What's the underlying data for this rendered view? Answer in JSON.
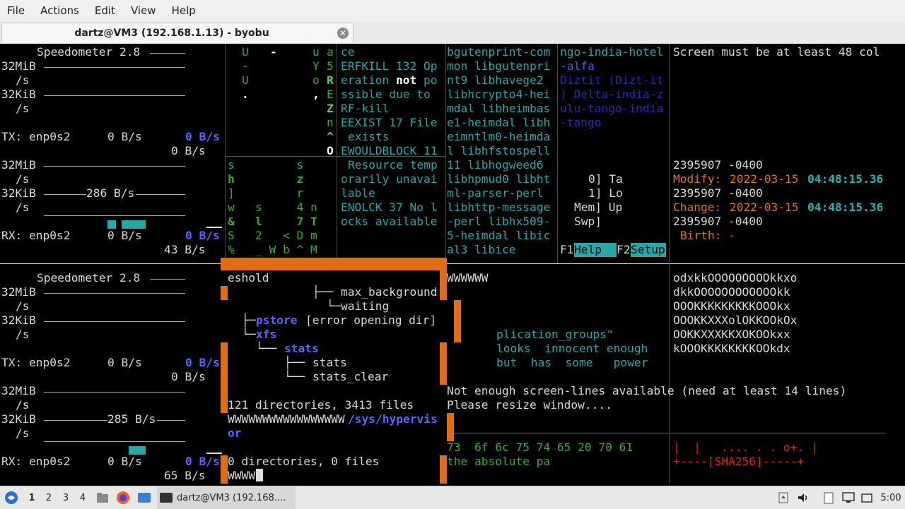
{
  "menubar": {
    "items": [
      "File",
      "Actions",
      "Edit",
      "View",
      "Help"
    ]
  },
  "tab": {
    "title": "dartz@VM3 (192.168.1.13) - byobu"
  },
  "monitor_top": {
    "title": "Speedometer 2.8",
    "scale1": "32MiB",
    "unit": "/s",
    "scale2": "32KiB",
    "tx_label": "TX: enp0s2",
    "tx_rate": "0 B/s",
    "tx_peak": "0 B/s",
    "tx_now": "0 B/s",
    "rate_mid": "286 B/s",
    "rx_label": "RX: enp0s2",
    "rx_rate": "0 B/s",
    "rx_peak": "0 B/s",
    "rx_now": "43 B/s"
  },
  "monitor_bottom": {
    "title": "Speedometer 2.8",
    "scale1": "32MiB",
    "unit": "/s",
    "scale2": "32KiB",
    "tx_label": "TX: enp0s2",
    "tx_rate": "0 B/s",
    "tx_peak": "0 B/s",
    "tx_now": "0 B/s",
    "rate_mid": "285 B/s",
    "rx_label": "RX: enp0s2",
    "rx_rate": "0 B/s",
    "rx_peak": "0 B/s",
    "rx_now": "65 B/s"
  },
  "matrix": {
    "rows": [
      {
        "a": "U",
        "b": "-",
        "c": "u",
        "d": "a"
      },
      {
        "a": "-",
        "b": "",
        "c": "Y",
        "d": "5"
      },
      {
        "a": "U",
        "b": "",
        "c": "o",
        "d": "R"
      },
      {
        "a": "",
        "b": ".",
        "c": ",",
        "d": "E"
      },
      {
        "a": "",
        "b": "",
        "c": "",
        "d": "Z"
      },
      {
        "a": "",
        "b": "",
        "c": "",
        "d": "n"
      },
      {
        "a": "",
        "b": "",
        "c": "",
        "d": "^"
      },
      {
        "a": "",
        "b": "",
        "c": "",
        "d": "O"
      }
    ],
    "rows2": [
      "s         s",
      "h         z",
      "]         r",
      "w   s     4 n",
      "&   l     7 T",
      "S   2   < D m",
      "%   _ W b ^ M"
    ]
  },
  "errors": [
    "ce",
    "ERFKILL 132 Op",
    "eration not po",
    "ssible due to",
    "RF-kill",
    "EEXIST 17 File",
    "exists",
    "EWOULDBLOCK 11",
    "Resource temp",
    "orarily unavai",
    "lable",
    "ENOLCK 37 No l",
    "ocks available"
  ],
  "packages": [
    "bgutenprint-com",
    "mon libgutenpri",
    "nt9 libhavege2",
    "libhcrypto4-hei",
    "mdal libheimbas",
    "e1-heimdal libh",
    "eimntlm0-heimda",
    "l libhfstospell",
    "11 libhogweed6",
    "libhpmud0 libht",
    "ml-parser-perl",
    "libhttp-message",
    "-perl libhx509-",
    "5-heimdal libic",
    "al3 libice"
  ],
  "phonetic": [
    "ngo-india-hotel",
    "-alfa",
    "Diztit (Dizt-it",
    ") Delta-india-z",
    "ulu-tango-india",
    "-tango"
  ],
  "htop": {
    "rows": [
      "0] Ta",
      "1] Lo",
      "Mem] Up",
      "Swp]"
    ],
    "f1": "F1",
    "help": "Help",
    "f2": "F2",
    "setup": "Setup"
  },
  "stat": {
    "warning": "Screen must be at least 48 col",
    "l1": "2395907 -0400",
    "modify_label": "Modify:",
    "modify_date": "2022-03-15",
    "modify_time": "04:48:15.36",
    "change_label": "Change:",
    "change_date": "2022-03-15",
    "change_time": "04:48:15.36",
    "birth": "Birth: -"
  },
  "tree": {
    "l1": "eshold",
    "l2": "max_background",
    "l3": "waiting",
    "pstore": "pstore",
    "pstore_err": "[error opening dir]",
    "xfs": "xfs",
    "stats_dir": "stats",
    "stats": "stats",
    "stats_clear": "stats_clear",
    "summary": "121 directories, 3413 files",
    "prefix": "WWWWWWWWWWWWWWWWW",
    "path": "/sys/hypervis",
    "path2": "or",
    "summary2": "0 directories, 0 files",
    "input": "WWWW"
  },
  "cowsay": {
    "top": "WWWWWW",
    "l1": "plication_groups\"",
    "l2": "looks  innocent enough",
    "l3": "but  has  some   power"
  },
  "ascii_art": [
    "odxkkOOOOOOOOOkkxo",
    "dkkOOOOOOOOOOOOkk",
    "OOOKKKKKKKKKOOOkx",
    "OOOKKXXXolOKKOOkOx",
    "OOKKXXXKKXOKOOkxx",
    "kOOOKKKKKKKKOOkdx"
  ],
  "notice": {
    "l1": "Not enough screen-lines available (need at least 14 lines)",
    "l2": "Please resize window...."
  },
  "hex": {
    "l1": "73  6f 6c 75 74 65 20 70 61",
    "l2": "the absolute pa"
  },
  "randomart": {
    "l1": "|  |   .... . . o+. |",
    "l2": "+----[SHA256]-----+"
  },
  "taskbar": {
    "workspaces": [
      "1",
      "2",
      "3",
      "4"
    ],
    "task": "dartz@VM3 (192.168....",
    "clock": "5:00"
  },
  "colors": {
    "cyan": "#2aa6a6",
    "blue": "#4a5ae8",
    "orange": "#e06c14",
    "green": "#3ca83c"
  }
}
